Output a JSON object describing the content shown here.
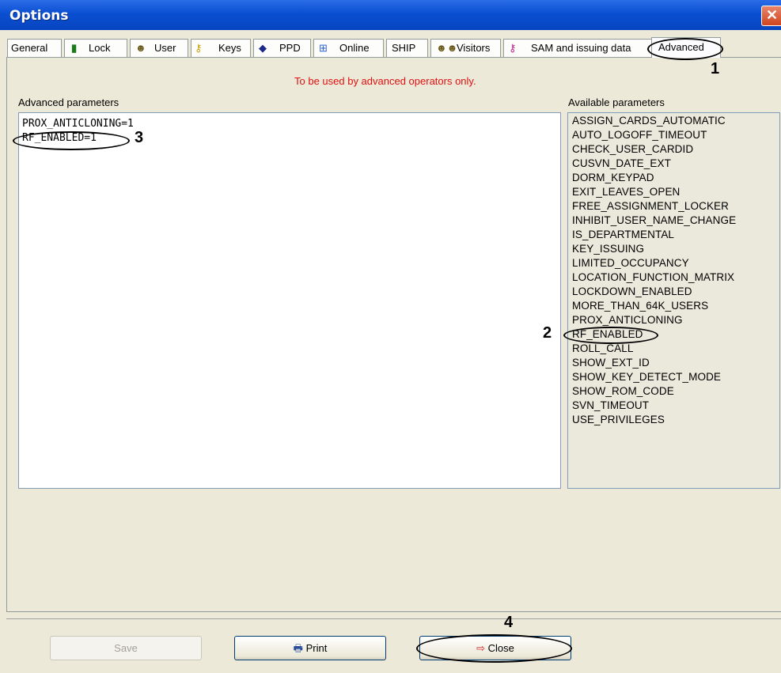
{
  "window": {
    "title": "Options",
    "close_glyph": "✕"
  },
  "tabs": [
    {
      "label": "General",
      "icon": ""
    },
    {
      "label": "Lock",
      "icon": "lock-door-icon"
    },
    {
      "label": "User",
      "icon": "user-icon"
    },
    {
      "label": "Keys",
      "icon": "key-icon"
    },
    {
      "label": "PPD",
      "icon": "ppd-device-icon"
    },
    {
      "label": "Online",
      "icon": "network-icon"
    },
    {
      "label": "SHIP",
      "icon": ""
    },
    {
      "label": "Visitors",
      "icon": "visitors-icon"
    },
    {
      "label": "SAM and issuing data",
      "icon": "key-icon"
    },
    {
      "label": "Advanced",
      "icon": ""
    }
  ],
  "active_tab": "Advanced",
  "warning": "To be used by advanced operators only.",
  "advanced": {
    "label": "Advanced parameters",
    "lines": [
      "PROX_ANTICLONING=1",
      "RF_ENABLED=1"
    ]
  },
  "available": {
    "label": "Available parameters",
    "items": [
      "ASSIGN_CARDS_AUTOMATIC",
      "AUTO_LOGOFF_TIMEOUT",
      "CHECK_USER_CARDID",
      "CUSVN_DATE_EXT",
      "DORM_KEYPAD",
      "EXIT_LEAVES_OPEN",
      "FREE_ASSIGNMENT_LOCKER",
      "INHIBIT_USER_NAME_CHANGE",
      "IS_DEPARTMENTAL",
      "KEY_ISSUING",
      "LIMITED_OCCUPANCY",
      "LOCATION_FUNCTION_MATRIX",
      "LOCKDOWN_ENABLED",
      "MORE_THAN_64K_USERS",
      "PROX_ANTICLONING",
      "RF_ENABLED",
      "ROLL_CALL",
      "SHOW_EXT_ID",
      "SHOW_KEY_DETECT_MODE",
      "SHOW_ROM_CODE",
      "SVN_TIMEOUT",
      "USE_PRIVILEGES"
    ]
  },
  "buttons": {
    "save": "Save",
    "print": "Print",
    "close": "Close"
  },
  "callouts": [
    "1",
    "2",
    "3",
    "4"
  ],
  "colors": {
    "warning": "#e01010",
    "titlebar": "#0a4fd1"
  }
}
